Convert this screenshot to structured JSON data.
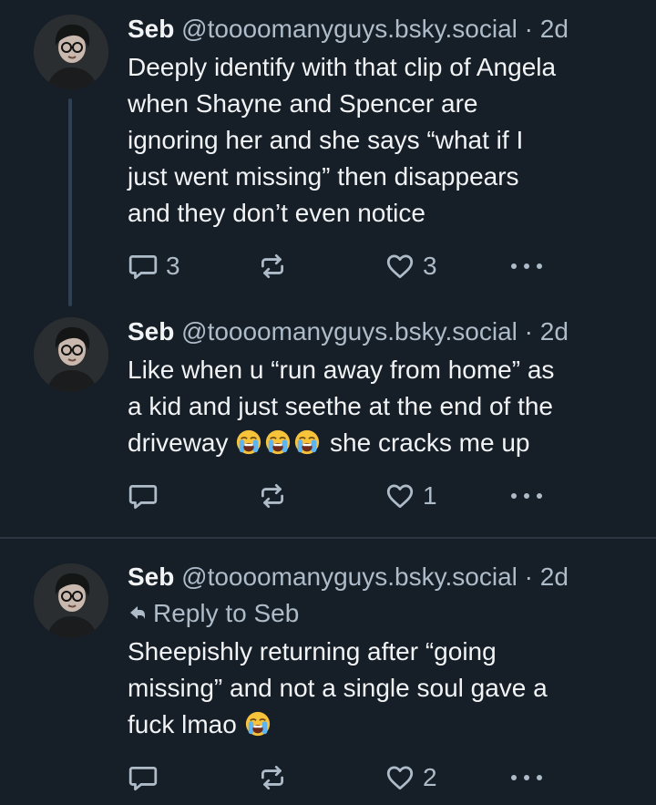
{
  "posts": [
    {
      "author": {
        "name": "Seb",
        "handle": "@toooomanyguys.bsky.social",
        "dot": "·",
        "time": "2d"
      },
      "text_lines": [
        "Deeply identify with that clip of Angela",
        "when Shayne and Spencer are",
        "ignoring her and she says “what if I",
        "just went missing” then disappears",
        "and they don’t even notice"
      ],
      "counts": {
        "replies": "3",
        "reposts": "",
        "likes": "3"
      }
    },
    {
      "author": {
        "name": "Seb",
        "handle": "@toooomanyguys.bsky.social",
        "dot": "·",
        "time": "2d"
      },
      "text_lines": [
        "Like when u “run away from home” as",
        "a kid and just seethe at the end of the"
      ],
      "text_line3_prefix": "driveway",
      "text_line3_suffix": "she cracks me up",
      "counts": {
        "replies": "",
        "reposts": "",
        "likes": "1"
      }
    },
    {
      "author": {
        "name": "Seb",
        "handle": "@toooomanyguys.bsky.social",
        "dot": "·",
        "time": "2d"
      },
      "reply_to": "Reply to Seb",
      "text_lines": [
        "Sheepishly returning after “going",
        "missing” and not a single soul gave a"
      ],
      "text_line3_prefix": "fuck lmao",
      "counts": {
        "replies": "",
        "reposts": "",
        "likes": "2"
      }
    }
  ],
  "icons": {
    "reply": "speech-bubble-icon",
    "repost": "repost-arrows-icon",
    "like": "heart-outline-icon",
    "more": "ellipsis-icon",
    "emoji": "loudly-crying-face-emoji"
  },
  "colors": {
    "background": "#161e27",
    "text": "#f1f3f5",
    "muted": "#aebbc9",
    "thread_line": "#2e4052",
    "divider": "#2b3642"
  }
}
